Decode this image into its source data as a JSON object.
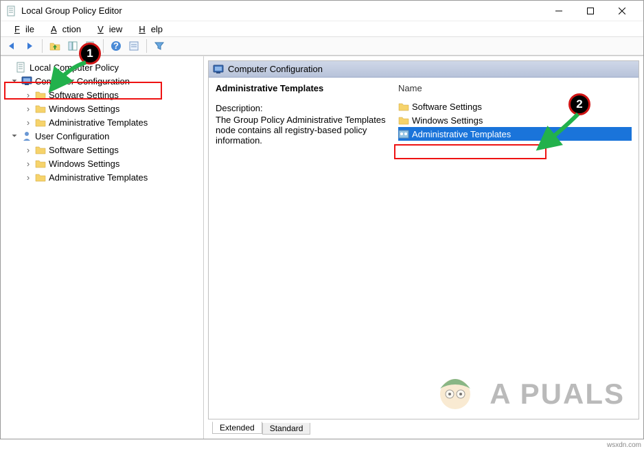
{
  "window": {
    "title": "Local Group Policy Editor"
  },
  "menu": {
    "file": "File",
    "action": "Action",
    "view": "View",
    "help": "Help"
  },
  "tree": {
    "root": "Local Computer Policy",
    "computer_config": "Computer Configuration",
    "cc_software": "Software Settings",
    "cc_windows": "Windows Settings",
    "cc_admin": "Administrative Templates",
    "user_config": "User Configuration",
    "uc_software": "Software Settings",
    "uc_windows": "Windows Settings",
    "uc_admin": "Administrative Templates"
  },
  "content": {
    "header": "Computer Configuration",
    "section_title": "Administrative Templates",
    "desc_label": "Description:",
    "desc_text": "The Group Policy Administrative Templates node contains all registry-based policy information.",
    "name_header": "Name",
    "items": {
      "software": "Software Settings",
      "windows": "Windows Settings",
      "admin": "Administrative Templates"
    }
  },
  "tabs": {
    "extended": "Extended",
    "standard": "Standard"
  },
  "annotations": {
    "one": "1",
    "two": "2"
  },
  "watermark": "A  PUALS",
  "credit": "wsxdn.com"
}
